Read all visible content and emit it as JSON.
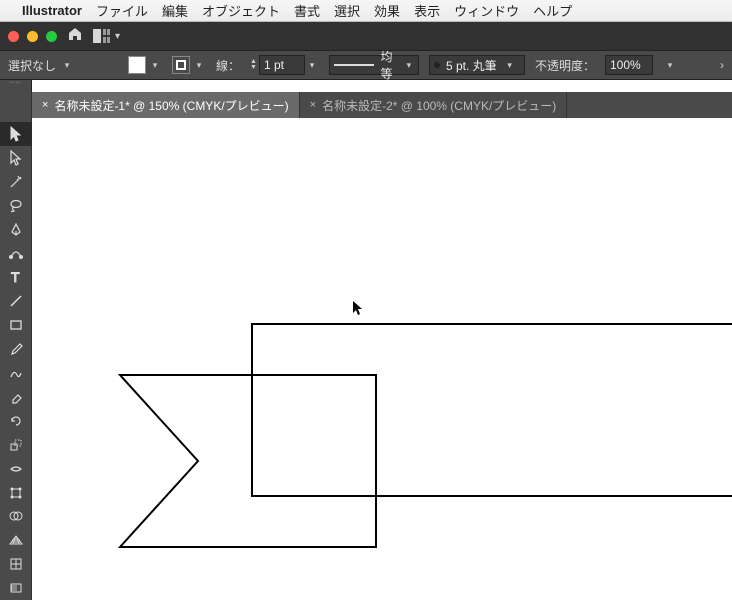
{
  "menubar": {
    "app_name": "Illustrator",
    "items": [
      "ファイル",
      "編集",
      "オブジェクト",
      "書式",
      "選択",
      "効果",
      "表示",
      "ウィンドウ",
      "ヘルプ"
    ]
  },
  "ctrlbar": {
    "selection_label": "選択なし",
    "stroke_label": "線：",
    "stroke_width": "1 pt",
    "stroke_profile": "均等",
    "brush": "5 pt. 丸筆",
    "opacity_label": "不透明度：",
    "opacity_value": "100%"
  },
  "tabs": [
    {
      "label": "名称未設定-1* @ 150% (CMYK/プレビュー)",
      "active": true
    },
    {
      "label": "名称未設定-2* @ 100% (CMYK/プレビュー)",
      "active": false
    }
  ],
  "tools": [
    "selection-tool",
    "direct-selection-tool",
    "magic-wand-tool",
    "lasso-tool",
    "pen-tool",
    "curvature-tool",
    "type-tool",
    "line-tool",
    "rectangle-tool",
    "paintbrush-tool",
    "shaper-tool",
    "eraser-tool",
    "rotate-tool",
    "scale-tool",
    "width-tool",
    "free-transform-tool",
    "shape-builder-tool",
    "perspective-grid-tool",
    "mesh-tool",
    "gradient-tool"
  ],
  "active_tool_index": 0
}
